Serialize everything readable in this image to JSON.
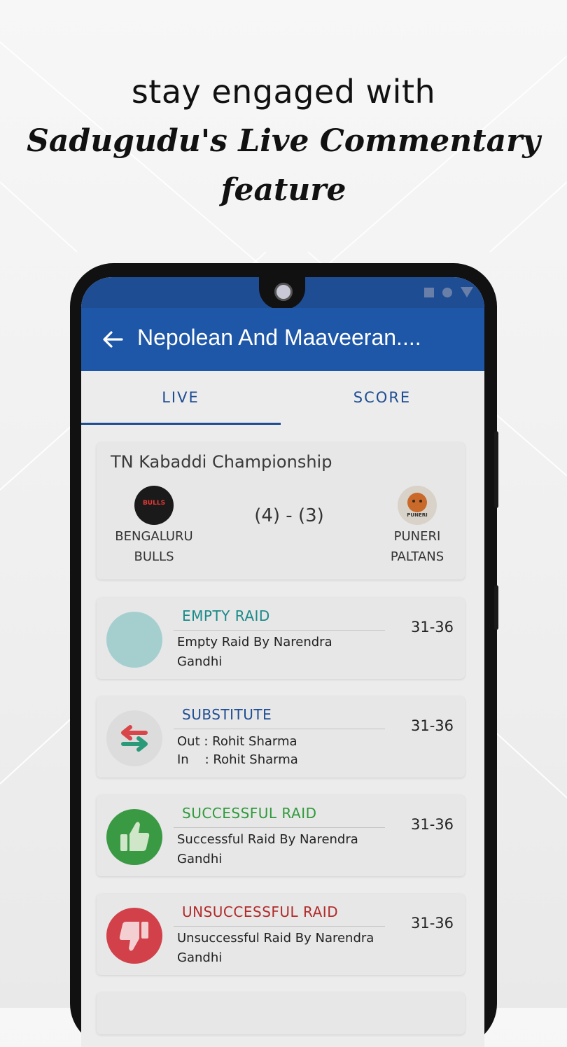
{
  "promo": {
    "line1": "stay engaged with",
    "line2": "Sadugudu's Live Commentary",
    "line3": "feature"
  },
  "appbar": {
    "back_icon": "arrow-left-icon",
    "title": "Nepolean And Maaveeran...."
  },
  "tabs": [
    {
      "label": "LIVE",
      "active": true
    },
    {
      "label": "SCORE",
      "active": false
    }
  ],
  "match": {
    "tournament": "TN Kabaddi Championship",
    "team_a": {
      "name_line1": "BENGALURU",
      "name_line2": "BULLS",
      "logo_text": "BULLS"
    },
    "team_b": {
      "name_line1": "PUNERI",
      "name_line2": "PALTANS",
      "logo_text": "PUNERI"
    },
    "score": "(4) - (3)"
  },
  "events": [
    {
      "type": "EMPTY RAID",
      "color": "#1a8a8a",
      "icon": "empty-circle-icon",
      "desc_line1": "Empty Raid By Narendra",
      "desc_line2": "Gandhi",
      "score": "31-36"
    },
    {
      "type": "SUBSTITUTE",
      "color": "#1e4d94",
      "icon": "swap-arrows-icon",
      "desc_line1": "Out : Rohit Sharma",
      "desc_line2": "In    : Rohit Sharma",
      "score": "31-36"
    },
    {
      "type": "SUCCESSFUL RAID",
      "color": "#2e9a3a",
      "icon": "thumbs-up-icon",
      "desc_line1": "Successful Raid By Narendra",
      "desc_line2": "Gandhi",
      "score": "31-36"
    },
    {
      "type": "UNSUCCESSFUL RAID",
      "color": "#b22a2a",
      "icon": "thumbs-down-icon",
      "desc_line1": "Unsuccessful Raid By Narendra",
      "desc_line2": "Gandhi",
      "score": "31-36"
    }
  ]
}
